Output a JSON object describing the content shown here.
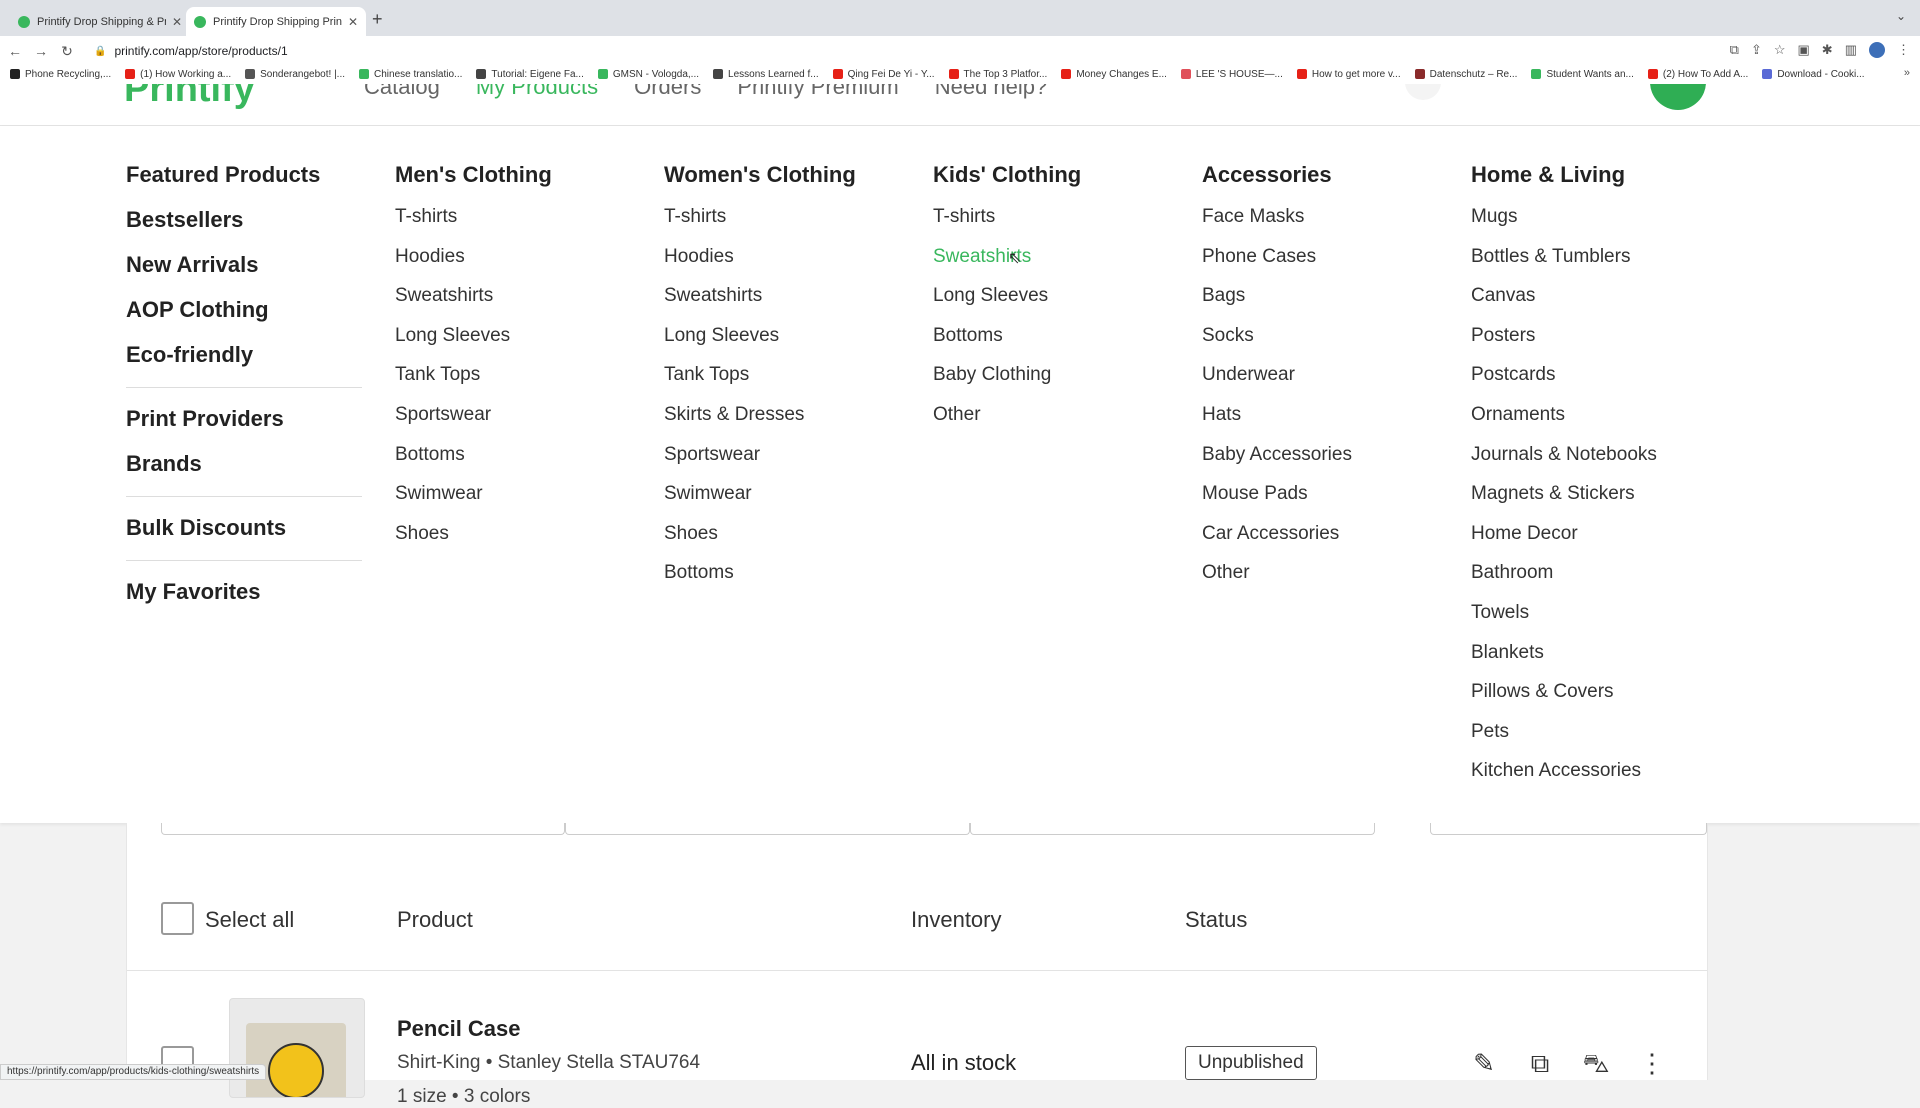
{
  "browser": {
    "tabs": [
      {
        "title": "Printify Drop Shipping & Printi"
      },
      {
        "title": "Printify Drop Shipping Print on"
      }
    ],
    "url": "printify.com/app/store/products/1",
    "status_url": "https://printify.com/app/products/kids-clothing/sweatshirts",
    "bookmarks": [
      {
        "label": "Phone Recycling,...",
        "color": "#222222"
      },
      {
        "label": "(1) How Working a...",
        "color": "#e62117"
      },
      {
        "label": "Sonderangebot! |...",
        "color": "#555555"
      },
      {
        "label": "Chinese translatio...",
        "color": "#39b75d"
      },
      {
        "label": "Tutorial: Eigene Fa...",
        "color": "#444444"
      },
      {
        "label": "GMSN - Vologda,...",
        "color": "#39b75d"
      },
      {
        "label": "Lessons Learned f...",
        "color": "#444444"
      },
      {
        "label": "Qing Fei De Yi - Y...",
        "color": "#e62117"
      },
      {
        "label": "The Top 3 Platfor...",
        "color": "#e62117"
      },
      {
        "label": "Money Changes E...",
        "color": "#e62117"
      },
      {
        "label": "LEE 'S HOUSE—...",
        "color": "#e0505a"
      },
      {
        "label": "How to get more v...",
        "color": "#e62117"
      },
      {
        "label": "Datenschutz – Re...",
        "color": "#8a2b2b"
      },
      {
        "label": "Student Wants an...",
        "color": "#39b75d"
      },
      {
        "label": "(2) How To Add A...",
        "color": "#e62117"
      },
      {
        "label": "Download - Cooki...",
        "color": "#5a6ad6"
      }
    ]
  },
  "header": {
    "logo": "Printify",
    "menu": [
      "Catalog",
      "My Products",
      "Orders",
      "Printify Premium",
      "Need help?"
    ]
  },
  "mega_menu": {
    "left": [
      "Featured Products",
      "Bestsellers",
      "New Arrivals",
      "AOP Clothing",
      "Eco-friendly",
      "Print Providers",
      "Brands",
      "Bulk Discounts",
      "My Favorites"
    ],
    "columns": [
      {
        "title": "Men's Clothing",
        "items": [
          "T-shirts",
          "Hoodies",
          "Sweatshirts",
          "Long Sleeves",
          "Tank Tops",
          "Sportswear",
          "Bottoms",
          "Swimwear",
          "Shoes"
        ]
      },
      {
        "title": "Women's Clothing",
        "items": [
          "T-shirts",
          "Hoodies",
          "Sweatshirts",
          "Long Sleeves",
          "Tank Tops",
          "Skirts & Dresses",
          "Sportswear",
          "Swimwear",
          "Shoes",
          "Bottoms"
        ]
      },
      {
        "title": "Kids' Clothing",
        "items": [
          "T-shirts",
          "Sweatshirts",
          "Long Sleeves",
          "Bottoms",
          "Baby Clothing",
          "Other"
        ],
        "active_item": "Sweatshirts"
      },
      {
        "title": "Accessories",
        "items": [
          "Face Masks",
          "Phone Cases",
          "Bags",
          "Socks",
          "Underwear",
          "Hats",
          "Baby Accessories",
          "Mouse Pads",
          "Car Accessories",
          "Other"
        ]
      },
      {
        "title": "Home & Living",
        "items": [
          "Mugs",
          "Bottles & Tumblers",
          "Canvas",
          "Posters",
          "Postcards",
          "Ornaments",
          "Journals & Notebooks",
          "Magnets & Stickers",
          "Home Decor",
          "Bathroom",
          "Towels",
          "Blankets",
          "Pillows & Covers",
          "Pets",
          "Kitchen Accessories"
        ]
      }
    ]
  },
  "table": {
    "select_all": "Select all",
    "headers": {
      "product": "Product",
      "inventory": "Inventory",
      "status": "Status"
    },
    "rows": [
      {
        "name": "Pencil Case",
        "provider": "Shirt-King • Stanley Stella STAU764",
        "variants": "1 size • 3 colors",
        "inventory": "All in stock",
        "status": "Unpublished"
      }
    ]
  },
  "colors": {
    "brand_green": "#39b75d"
  }
}
